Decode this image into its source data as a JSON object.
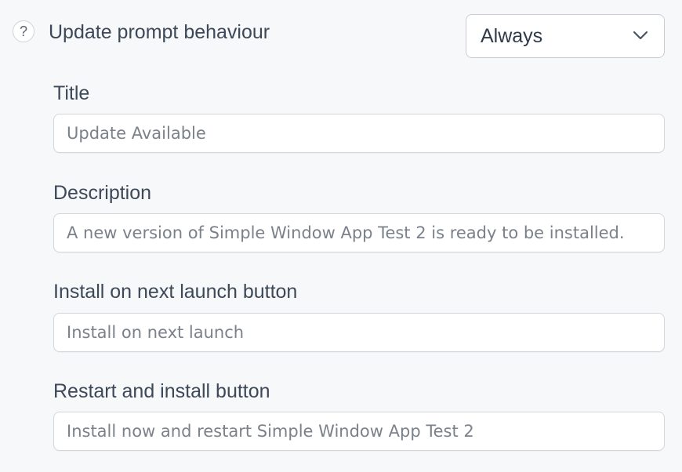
{
  "setting": {
    "help_icon": "?",
    "label": "Update prompt behaviour",
    "select_value": "Always",
    "chevron_icon": "chevron-down-icon"
  },
  "fields": [
    {
      "label": "Title",
      "placeholder": "Update Available"
    },
    {
      "label": "Description",
      "placeholder": "A new version of Simple Window App Test 2 is ready to be installed."
    },
    {
      "label": "Install on next launch button",
      "placeholder": "Install on next launch"
    },
    {
      "label": "Restart and install button",
      "placeholder": "Install now and restart Simple Window App Test 2"
    }
  ]
}
